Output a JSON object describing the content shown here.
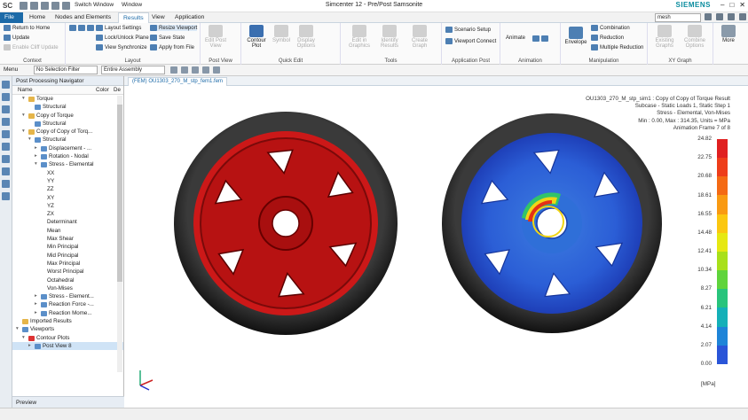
{
  "titlebar": {
    "logo": "SC",
    "switch_window": "Switch Window",
    "window": "Window",
    "app_title": "Simcenter 12 - Pre/Post Samsonite",
    "brand": "SIEMENS"
  },
  "menu_tabs": [
    "File",
    "Home",
    "Nodes and Elements",
    "Results",
    "View",
    "Application"
  ],
  "search_value": "mesh",
  "ribbon": {
    "context": {
      "label": "Context",
      "items": [
        "Return to Home",
        "Update",
        "Enable Cliff Update"
      ]
    },
    "layout": {
      "label": "Layout",
      "items": [
        "Layout Settings",
        "Lock/Unlock Plane",
        "View Synchronize",
        "Resize Viewport",
        "Save State",
        "Apply from File"
      ]
    },
    "post_view": {
      "label": "Post View",
      "items": [
        "Edit Post View",
        "Contour Plot"
      ]
    },
    "quick_edit": {
      "label": "Quick Edit",
      "items": [
        "Symbol",
        "Display Options"
      ]
    },
    "tools": {
      "label": "Tools",
      "items": [
        "Edit in Graphics",
        "Identify Results",
        "Create Graph"
      ]
    },
    "application_post": {
      "label": "Application Post",
      "items": [
        "Scenario Setup",
        "Viewport Connect"
      ]
    },
    "animation": {
      "label": "Animation",
      "items": [
        "Animate"
      ]
    },
    "manipulation": {
      "label": "Manipulation",
      "items": [
        "Envelope",
        "Combination",
        "Reduction",
        "Multiple Reduction"
      ]
    },
    "xy_graph": {
      "label": "XY Graph",
      "items": [
        "Existing Graphs",
        "Combine Options"
      ]
    },
    "more": "More"
  },
  "toolbar2": {
    "menu": "Menu",
    "filter": "No Selection Filter",
    "assembly": "Entire Assembly"
  },
  "navigator": {
    "title": "Post Processing Navigator",
    "columns": [
      "Name",
      "Color",
      "De"
    ],
    "rows": [
      {
        "label": "Torque",
        "indent": 1,
        "icon": "fold",
        "exp": "-"
      },
      {
        "label": "Structural",
        "indent": 2,
        "icon": "res",
        "exp": ""
      },
      {
        "label": "Copy of Torque",
        "indent": 1,
        "icon": "fold",
        "exp": "-"
      },
      {
        "label": "Structural",
        "indent": 2,
        "icon": "res",
        "exp": ""
      },
      {
        "label": "Copy of Copy of Torq...",
        "indent": 1,
        "icon": "fold",
        "exp": "-"
      },
      {
        "label": "Structural",
        "indent": 2,
        "icon": "res",
        "exp": "-"
      },
      {
        "label": "Displacement - ...",
        "indent": 3,
        "icon": "res",
        "exp": "+"
      },
      {
        "label": "Rotation - Nodal",
        "indent": 3,
        "icon": "res",
        "exp": "+"
      },
      {
        "label": "Stress - Elemental",
        "indent": 3,
        "icon": "res",
        "exp": "-"
      },
      {
        "label": "XX",
        "indent": 4,
        "icon": "",
        "exp": ""
      },
      {
        "label": "YY",
        "indent": 4,
        "icon": "",
        "exp": ""
      },
      {
        "label": "ZZ",
        "indent": 4,
        "icon": "",
        "exp": ""
      },
      {
        "label": "XY",
        "indent": 4,
        "icon": "",
        "exp": ""
      },
      {
        "label": "YZ",
        "indent": 4,
        "icon": "",
        "exp": ""
      },
      {
        "label": "ZX",
        "indent": 4,
        "icon": "",
        "exp": ""
      },
      {
        "label": "Determinant",
        "indent": 4,
        "icon": "",
        "exp": ""
      },
      {
        "label": "Mean",
        "indent": 4,
        "icon": "",
        "exp": ""
      },
      {
        "label": "Max Shear",
        "indent": 4,
        "icon": "",
        "exp": ""
      },
      {
        "label": "Min Principal",
        "indent": 4,
        "icon": "",
        "exp": ""
      },
      {
        "label": "Mid Principal",
        "indent": 4,
        "icon": "",
        "exp": ""
      },
      {
        "label": "Max Principal",
        "indent": 4,
        "icon": "",
        "exp": ""
      },
      {
        "label": "Worst Principal",
        "indent": 4,
        "icon": "",
        "exp": ""
      },
      {
        "label": "Octahedral",
        "indent": 4,
        "icon": "",
        "exp": ""
      },
      {
        "label": "Von-Mises",
        "indent": 4,
        "icon": "",
        "exp": ""
      },
      {
        "label": "Stress - Element...",
        "indent": 3,
        "icon": "res",
        "exp": "+"
      },
      {
        "label": "Reaction Force -...",
        "indent": 3,
        "icon": "res",
        "exp": "+"
      },
      {
        "label": "Reaction Mome...",
        "indent": 3,
        "icon": "res",
        "exp": "+"
      },
      {
        "label": "Imported Results",
        "indent": 0,
        "icon": "fold",
        "exp": ""
      },
      {
        "label": "Viewports",
        "indent": 0,
        "icon": "res",
        "exp": "-"
      },
      {
        "label": "Contour Plots",
        "indent": 1,
        "icon": "red",
        "exp": "-"
      },
      {
        "label": "Post View 8",
        "indent": 2,
        "icon": "res",
        "exp": "+"
      }
    ],
    "preview": "Preview"
  },
  "viewport_tab": "(FEM) OU1303_270_M_stp_fem1.fem",
  "result_header": [
    "OU1303_270_M_stp_sim1 : Copy of Copy of Torque Result",
    "Subcase - Static Loads 1, Static Step 1",
    "Stress - Elemental, Von-Mises",
    "Min : 0.00, Max : 314.35, Units = MPa",
    "Animation Frame 7 of 8"
  ],
  "legend": {
    "labels": [
      "24.82",
      "22.75",
      "20.68",
      "18.61",
      "16.55",
      "14.48",
      "12.41",
      "10.34",
      "8.27",
      "6.21",
      "4.14",
      "2.07",
      "0.00"
    ],
    "colors": [
      "#e02020",
      "#ee3d1a",
      "#f46a14",
      "#f99a12",
      "#fbc710",
      "#e6e812",
      "#a8e01a",
      "#5fd43c",
      "#28c47c",
      "#14b0b8",
      "#1e84d8",
      "#2a55d8",
      "#1e2fc8"
    ],
    "units": "[MPa]"
  }
}
